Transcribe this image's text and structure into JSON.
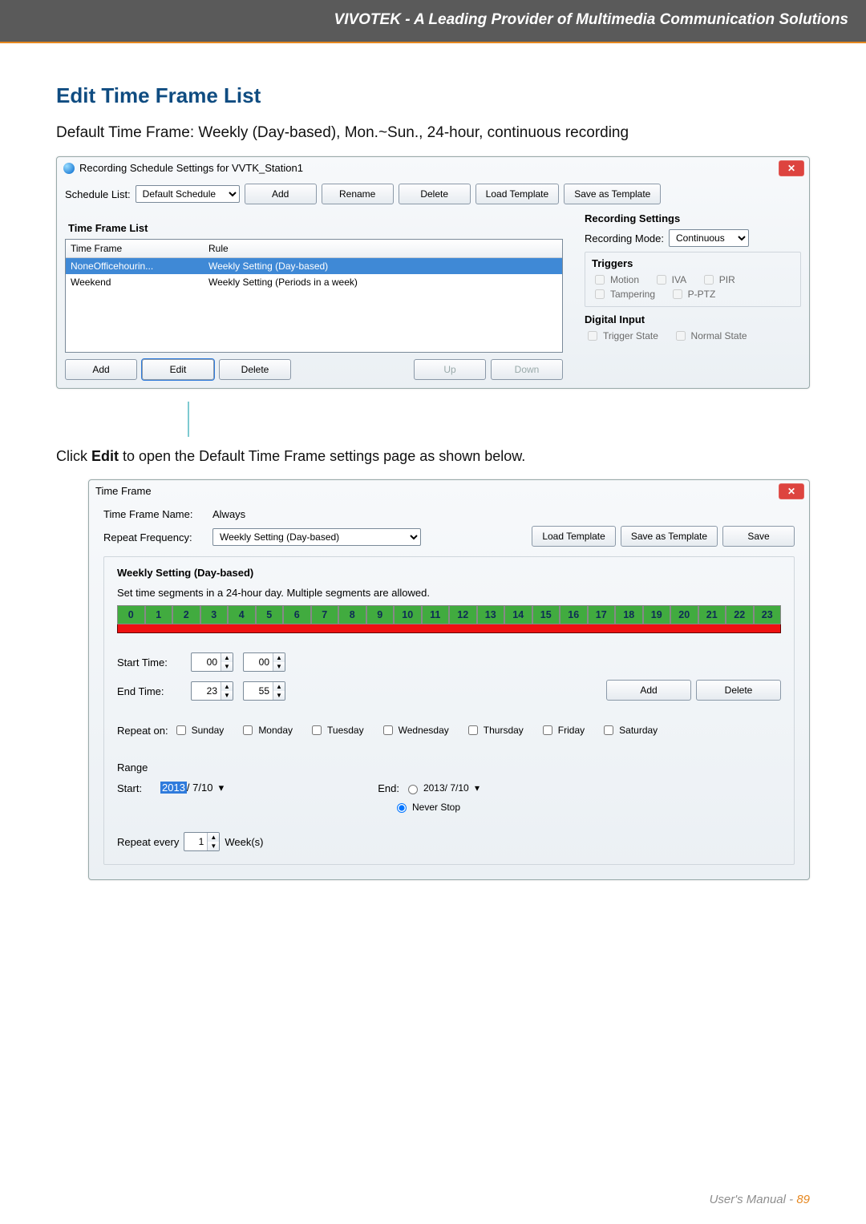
{
  "header": {
    "banner": "VIVOTEK - A Leading Provider of Multimedia Communication Solutions"
  },
  "section": {
    "title": "Edit Time Frame List",
    "intro": "Default Time Frame: Weekly (Day-based), Mon.~Sun., 24-hour, continuous recording",
    "instr": "Click Edit to open the Default Time Frame settings page as shown below.",
    "instr_pre": "Click ",
    "instr_bold": "Edit",
    "instr_post": " to open the Default Time Frame settings page as shown below."
  },
  "win1": {
    "title": "Recording Schedule Settings for VVTK_Station1",
    "schedule_list_lbl": "Schedule List:",
    "schedule_selected": "Default Schedule",
    "btns": {
      "add": "Add",
      "rename": "Rename",
      "delete": "Delete",
      "load": "Load Template",
      "save": "Save as Template"
    },
    "tf_list_title": "Time Frame List",
    "cols": {
      "tf": "Time Frame",
      "rule": "Rule"
    },
    "rows": [
      {
        "tf": "NoneOfficehourin...",
        "rule": "Weekly Setting (Day-based)",
        "sel": true
      },
      {
        "tf": "Weekend",
        "rule": "Weekly Setting (Periods in a week)",
        "sel": false
      }
    ],
    "btns2": {
      "add": "Add",
      "edit": "Edit",
      "delete": "Delete",
      "up": "Up",
      "down": "Down"
    },
    "rec": {
      "title": "Recording Settings",
      "mode_lbl": "Recording Mode:",
      "mode_val": "Continuous",
      "triggers_title": "Triggers",
      "trig": {
        "motion": "Motion",
        "iva": "IVA",
        "pir": "PIR",
        "tamp": "Tampering",
        "pptz": "P-PTZ"
      },
      "di_title": "Digital Input",
      "di": {
        "ts": "Trigger State",
        "ns": "Normal State"
      }
    }
  },
  "win2": {
    "title": "Time Frame",
    "name_lbl": "Time Frame Name:",
    "name_val": "Always",
    "btns": {
      "load": "Load Template",
      "save_t": "Save as Template",
      "save": "Save"
    },
    "freq_lbl": "Repeat Frequency:",
    "freq_val": "Weekly Setting (Day-based)",
    "weekly_title": "Weekly Setting (Day-based)",
    "weekly_desc": "Set time segments in a 24-hour day. Multiple segments are allowed.",
    "hours": [
      "0",
      "1",
      "2",
      "3",
      "4",
      "5",
      "6",
      "7",
      "8",
      "9",
      "10",
      "11",
      "12",
      "13",
      "14",
      "15",
      "16",
      "17",
      "18",
      "19",
      "20",
      "21",
      "22",
      "23"
    ],
    "start_lbl": "Start Time:",
    "start_h": "00",
    "start_m": "00",
    "end_lbl": "End Time:",
    "end_h": "23",
    "end_m": "55",
    "add": "Add",
    "delete": "Delete",
    "repeat_lbl": "Repeat on:",
    "days": {
      "sun": "Sunday",
      "mon": "Monday",
      "tue": "Tuesday",
      "wed": "Wednesday",
      "thu": "Thursday",
      "fri": "Friday",
      "sat": "Saturday"
    },
    "range_title": "Range",
    "range_start_lbl": "Start:",
    "range_start_y": "2013",
    "range_start_rest": "/ 7/10",
    "range_end_lbl": "End:",
    "range_end_val": "2013/ 7/10",
    "never": "Never Stop",
    "repeat_every_lbl": "Repeat every",
    "repeat_every_val": "1",
    "repeat_every_unit": "Week(s)"
  },
  "footer": {
    "text": "User's Manual - ",
    "page": "89"
  }
}
